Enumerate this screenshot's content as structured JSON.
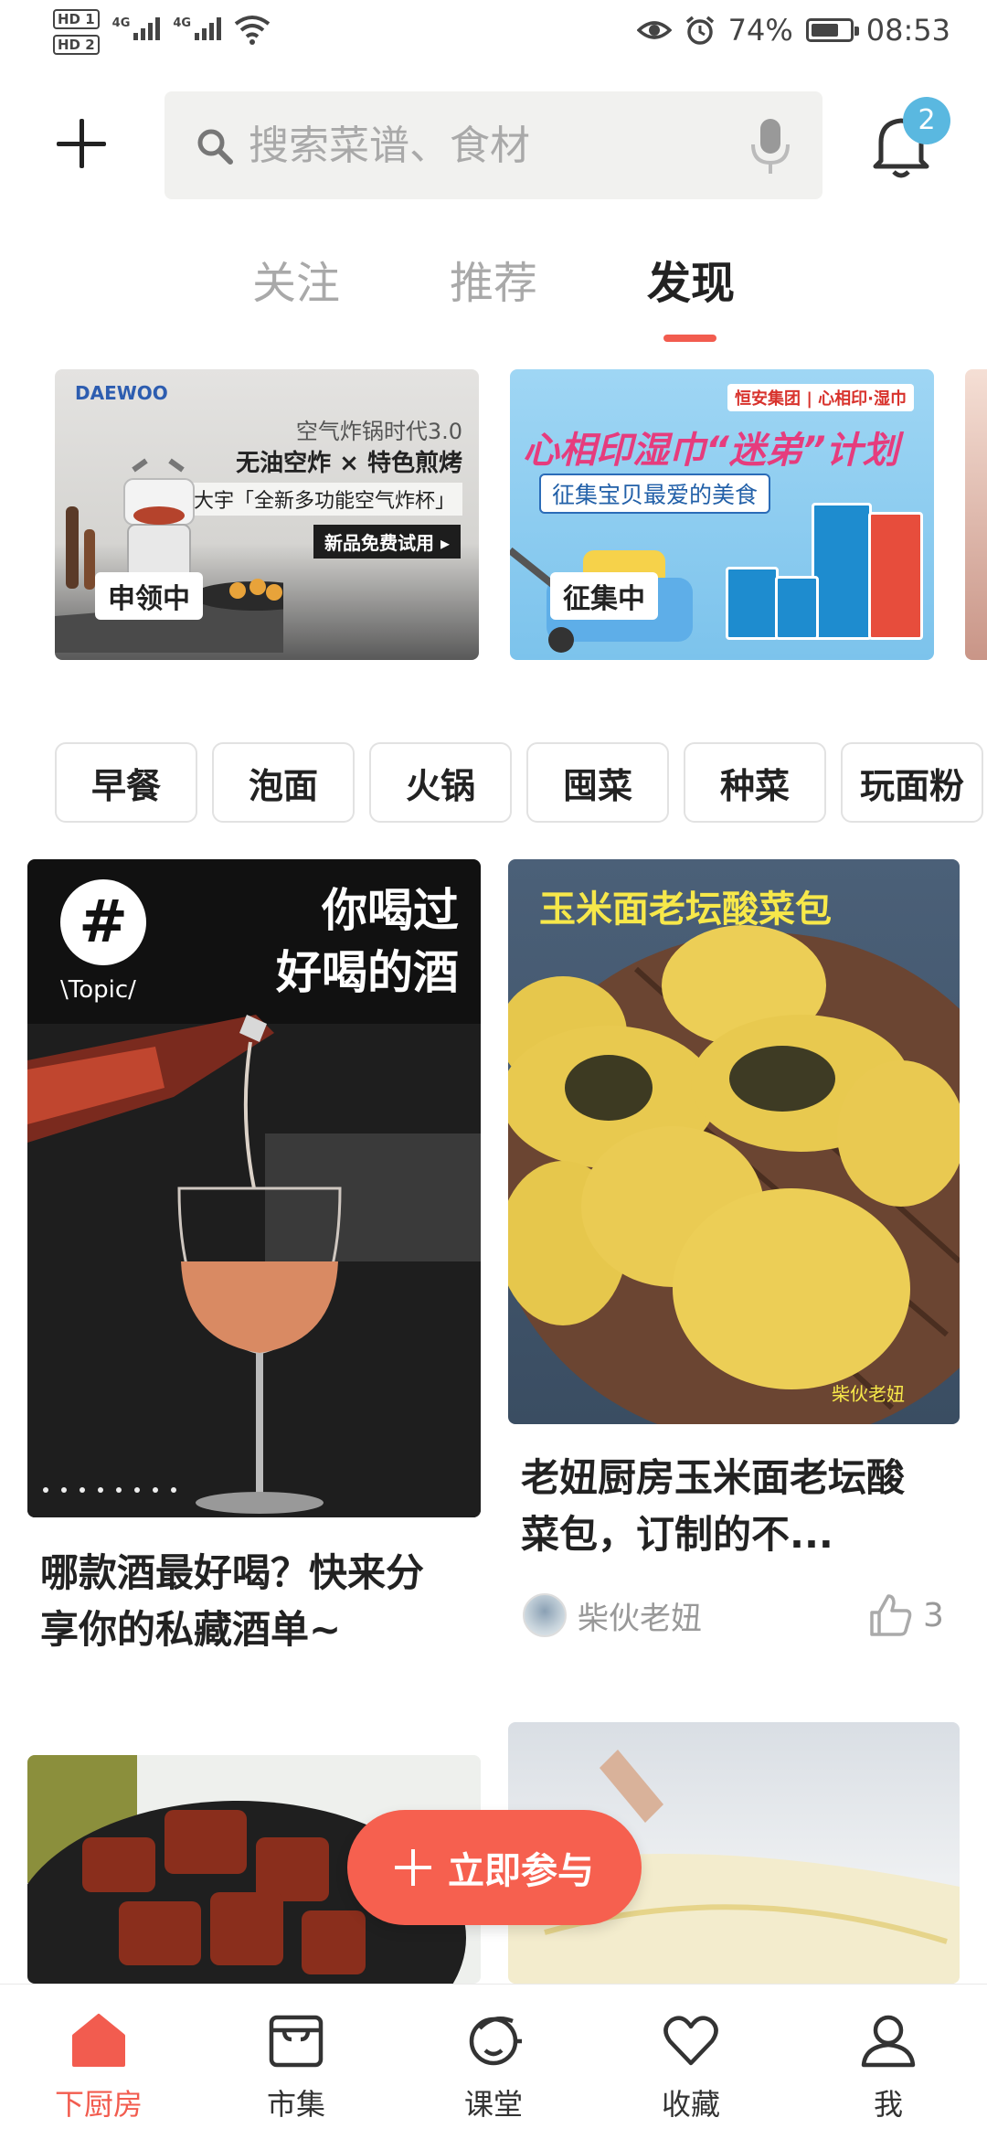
{
  "status_bar": {
    "hd1": "HD 1",
    "hd2": "HD 2",
    "net1": "4G",
    "net2": "4G",
    "battery_percent": "74%",
    "battery_level": 0.74,
    "time": "08:53"
  },
  "header": {
    "search_placeholder": "搜索菜谱、食材",
    "notification_count": "2"
  },
  "tabs": [
    {
      "label": "关注",
      "active": false
    },
    {
      "label": "推荐",
      "active": false
    },
    {
      "label": "发现",
      "active": true
    }
  ],
  "banners": [
    {
      "tag": "申领中",
      "brand": "DAEWOO",
      "line1": "空气炸锅时代3.0",
      "line2": "无油空炸 × 特色煎烤",
      "line3": "大宇「全新多功能空气炸杯」",
      "cta": "新品免费试用 ▸"
    },
    {
      "tag": "征集中",
      "brand": "恒安集团 | 心相印·湿巾",
      "line1": "心相印湿巾“迷弟”计划",
      "line2": "征集宝贝最爱的美食"
    }
  ],
  "chips": [
    "早餐",
    "泡面",
    "火锅",
    "囤菜",
    "种菜",
    "玩面粉"
  ],
  "feed": [
    {
      "image_topic_mark": "#",
      "image_topic_text": "\\Topic/",
      "image_title_line1": "你喝过",
      "image_title_line2": "好喝的酒",
      "title": "哪款酒最好喝？快来分享你的私藏酒单~"
    },
    {
      "image_title": "玉米面老坛酸菜包",
      "image_watermark": "柴伙老妞",
      "title": "老妞厨房玉米面老坛酸菜包，订制的不...",
      "author": "柴伙老妞",
      "likes": "3"
    }
  ],
  "join_button": {
    "label": "立即参与"
  },
  "bottom_nav": [
    {
      "label": "下厨房",
      "active": true
    },
    {
      "label": "市集",
      "active": false
    },
    {
      "label": "课堂",
      "active": false
    },
    {
      "label": "收藏",
      "active": false
    },
    {
      "label": "我",
      "active": false
    }
  ],
  "colors": {
    "accent": "#f25c4f",
    "badge": "#5ab8e0",
    "text_dark": "#222222",
    "text_muted": "#999999"
  }
}
